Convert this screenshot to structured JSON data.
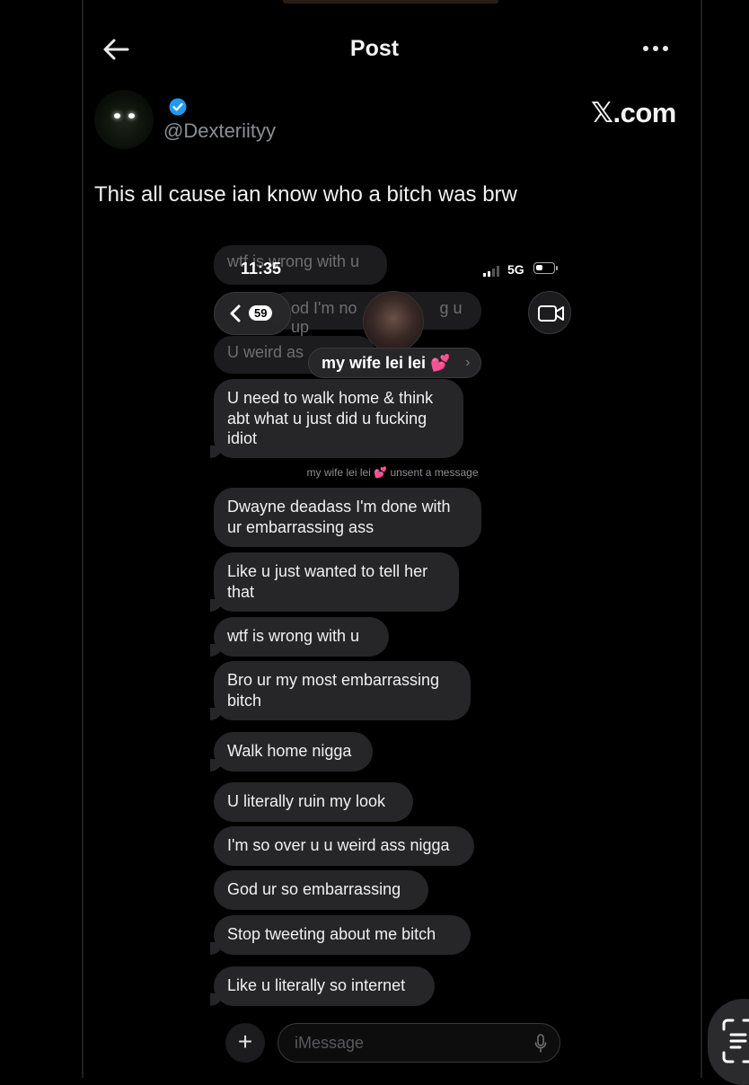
{
  "header": {
    "title": "Post"
  },
  "profile": {
    "handle": "@Dexteriityy",
    "verified": true,
    "watermark": "𝕏.com"
  },
  "tweet": {
    "text": "This all cause ian know who a bitch was brw"
  },
  "screenshot": {
    "status_bar": {
      "time": "11:35",
      "network": "5G",
      "battery_icon": "battery-icon"
    },
    "ghost_messages": [
      "wtf is wrong with u",
      "od I'm no",
      "g u up",
      "U weird as"
    ],
    "nav": {
      "back_count": "59",
      "contact_name": "my wife lei lei 💕",
      "contact_chevron": "›"
    },
    "unsent_notice": "my wife lei lei 💕  unsent a message",
    "messages": [
      "U need to walk home & think abt what u just did u fucking idiot",
      "Dwayne deadass I'm done with ur embarrassing ass",
      "Like u just wanted to tell her that",
      "wtf is wrong with u",
      "Bro ur my most embarrassing bitch",
      "Walk home nigga",
      "U literally ruin my look",
      "I'm so over u u weird ass nigga",
      "God ur so embarrassing",
      "Stop tweeting about me bitch",
      "Like u literally so internet"
    ],
    "input": {
      "placeholder": "iMessage",
      "plus": "+"
    }
  },
  "colors": {
    "background": "#000000",
    "bubble": "#262628",
    "verified": "#1d9bf0",
    "text_muted": "#8b8f94"
  },
  "icons": [
    "back-arrow-icon",
    "more-icon",
    "verified-icon",
    "chevron-left-icon",
    "video-camera-icon",
    "plus-icon",
    "microphone-icon",
    "scan-icon"
  ]
}
